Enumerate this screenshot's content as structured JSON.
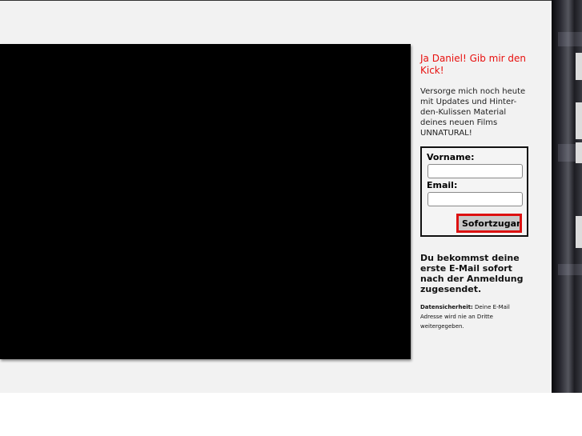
{
  "signup": {
    "headline": "Ja Daniel! Gib mir den Kick!",
    "intro": "Versorge mich noch heute mit Updates und Hinter-den-Kulissen Material deines neuen Films UNNATURAL!",
    "first_name_label": "Vorname:",
    "first_name_value": "",
    "email_label": "Email:",
    "email_value": "",
    "submit_label": "Sofortzugang",
    "confirmation": "Du bekommst deine erste E-Mail sofort nach der Anmeldung zugesendet.",
    "privacy_label": "Datensicherheit:",
    "privacy_text": "Deine E-Mail Adresse wird nie an Dritte weitergegeben."
  },
  "colors": {
    "headline": "#e8100e",
    "button_border": "#dd1111",
    "video_background": "#000000",
    "page_background": "#f2f2f2"
  }
}
